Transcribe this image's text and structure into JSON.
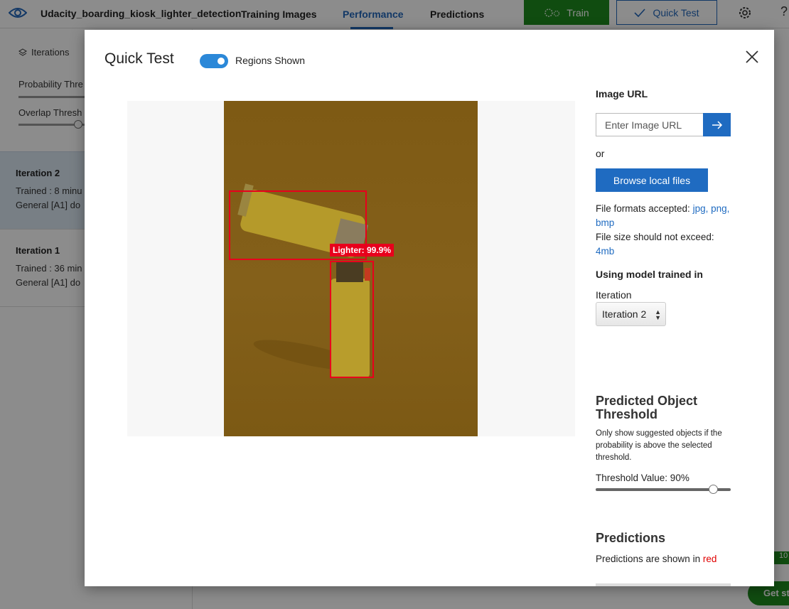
{
  "topbar": {
    "project_name": "Udacity_boarding_kiosk_lighter_detection",
    "tabs": [
      "Training Images",
      "Performance",
      "Predictions"
    ],
    "active_tab": "Performance",
    "train_label": "Train",
    "quick_test_label": "Quick Test"
  },
  "sidebar": {
    "iterations_label": "Iterations",
    "probability_label": "Probability Thre",
    "overlap_label": "Overlap Thresh",
    "items": [
      {
        "title": "Iteration 2",
        "trained": "Trained : 8 minu",
        "domain": "General [A1] do"
      },
      {
        "title": "Iteration 1",
        "trained": "Trained : 36 min",
        "domain": "General [A1] do"
      }
    ]
  },
  "bottom": {
    "badge": "10",
    "get_started": "Get st"
  },
  "modal": {
    "title": "Quick Test",
    "regions_label": "Regions Shown",
    "regions_on": true,
    "prediction": {
      "tag": "Lighter",
      "probability": "99.9%",
      "label": "Lighter: 99.9%"
    },
    "side": {
      "image_url_heading": "Image URL",
      "url_placeholder": "Enter Image URL",
      "or_label": "or",
      "browse_label": "Browse local files",
      "formats_label": "File formats accepted:",
      "formats": "jpg, png, bmp",
      "size_label": "File size should not exceed:",
      "size_value": "4mb",
      "model_heading": "Using model trained in",
      "iteration_label": "Iteration",
      "iteration_value": "Iteration 2",
      "threshold_heading": "Predicted Object Threshold",
      "threshold_desc": "Only show suggested objects if the probability is above the selected threshold.",
      "threshold_value_label": "Threshold Value: 90%",
      "threshold_value": 0.9,
      "predictions_heading": "Predictions",
      "predictions_desc": "Predictions are shown in",
      "predictions_color_word": "red"
    }
  },
  "colors": {
    "accent": "#1f6bc1",
    "train": "#1e8a1e",
    "region": "#e8001c"
  }
}
